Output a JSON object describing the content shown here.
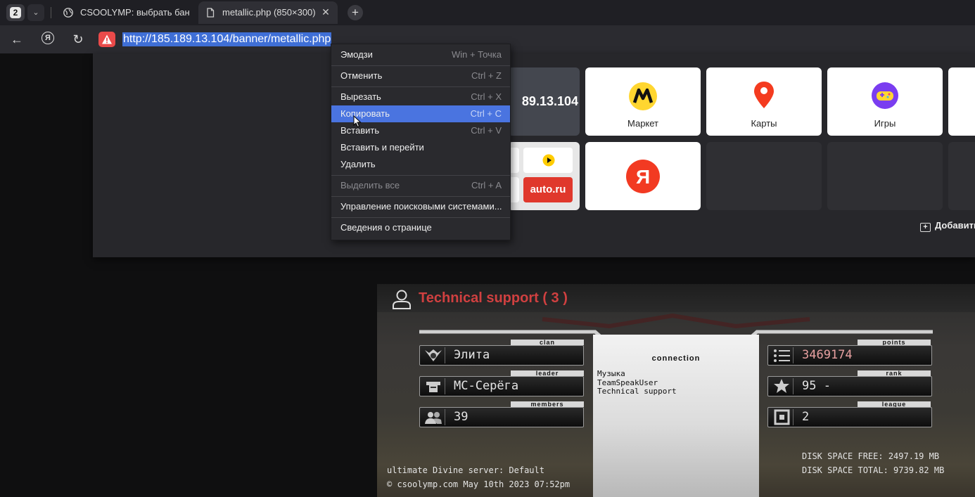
{
  "browser": {
    "tab_count": "2",
    "tabs": [
      {
        "label": "CSOOLYMP: выбрать баннер"
      },
      {
        "label": "metallic.php (850×300)"
      }
    ],
    "address": "http://185.189.13.104/banner/metallic.php"
  },
  "speed_dial": {
    "ip_tile": "89.13.104",
    "tiles": [
      {
        "label": "Маркет"
      },
      {
        "label": "Карты"
      },
      {
        "label": "Игры"
      }
    ],
    "auto_label": "auto.ru",
    "add_label": "Добавить"
  },
  "context_menu": {
    "items": [
      {
        "label": "Эмодзи",
        "key": "Win + Точка"
      },
      {
        "label": "Отменить",
        "key": "Ctrl + Z"
      },
      {
        "label": "Вырезать",
        "key": "Ctrl + X"
      },
      {
        "label": "Копировать",
        "key": "Ctrl + C"
      },
      {
        "label": "Вставить",
        "key": "Ctrl + V"
      },
      {
        "label": "Вставить и перейти",
        "key": ""
      },
      {
        "label": "Удалить",
        "key": ""
      },
      {
        "label": "Выделить все",
        "key": "Ctrl + A"
      },
      {
        "label": "Управление поисковыми системами...",
        "key": ""
      },
      {
        "label": "Сведения о странице",
        "key": ""
      }
    ]
  },
  "banner": {
    "title": "Technical support ( 3 )",
    "left": {
      "clan_label": "clan",
      "clan": "Элита",
      "leader_label": "leader",
      "leader": "МС-Серёга",
      "members_label": "members",
      "members": "39"
    },
    "connection": {
      "title": "connection",
      "users": [
        "Музыка",
        "TeamSpeakUser",
        "Technical support"
      ]
    },
    "right": {
      "points_label": "points",
      "points": "3469174",
      "rank_label": "rank",
      "rank": "95 -",
      "league_label": "league",
      "league": "2"
    },
    "server": "ultimate Divine server: Default",
    "copyright": "© csoolymp.com May 10th 2023 07:52pm",
    "disk_free": "DISK SPACE FREE: 2497.19 MB",
    "disk_total": "DISK SPACE TOTAL: 9739.82 MB"
  },
  "colors": {
    "menu_highlight": "#4a74e0",
    "selection": "#3f6fd6",
    "banner_title": "#d04040"
  }
}
